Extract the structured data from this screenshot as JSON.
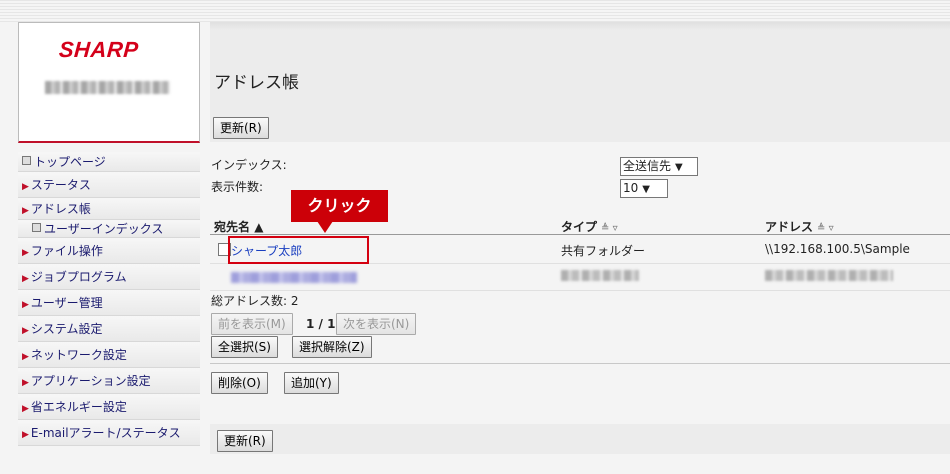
{
  "brand": "SHARP",
  "page": {
    "title": "アドレス帳",
    "update_button": "更新(R)"
  },
  "sidebar": {
    "items": [
      {
        "label": "トップページ",
        "marker": "square"
      },
      {
        "label": "ステータス",
        "marker": "triangle"
      },
      {
        "label": "アドレス帳",
        "marker": "triangle"
      },
      {
        "label": "ユーザーインデックス",
        "marker": "square"
      },
      {
        "label": "ファイル操作",
        "marker": "triangle"
      },
      {
        "label": "ジョブプログラム",
        "marker": "triangle"
      },
      {
        "label": "ユーザー管理",
        "marker": "triangle"
      },
      {
        "label": "システム設定",
        "marker": "triangle"
      },
      {
        "label": "ネットワーク設定",
        "marker": "triangle"
      },
      {
        "label": "アプリケーション設定",
        "marker": "triangle"
      },
      {
        "label": "省エネルギー設定",
        "marker": "triangle"
      },
      {
        "label": "E-mailアラート/ステータス",
        "marker": "triangle"
      }
    ]
  },
  "filters": {
    "index_label": "インデックス:",
    "index_value": "全送信先",
    "count_label": "表示件数:",
    "count_value": "10"
  },
  "table": {
    "columns": [
      "宛先名",
      "タイプ",
      "アドレス"
    ],
    "rows": [
      {
        "name": "シャープ太郎",
        "type": "共有フォルダー",
        "address": "\\\\192.168.100.5\\Sample"
      }
    ]
  },
  "summary": {
    "total_label": "総アドレス数:",
    "total_value": "2",
    "pager": "1 / 1"
  },
  "buttons": {
    "prev": "前を表示(M)",
    "next": "次を表示(N)",
    "select_all": "全選択(S)",
    "deselect": "選択解除(Z)",
    "delete": "削除(O)",
    "add": "追加(Y)"
  },
  "callout": "クリック",
  "colors": {
    "brand_red": "#d4001a",
    "callout_red": "#cc0008",
    "link_blue": "#1a3fc0"
  }
}
